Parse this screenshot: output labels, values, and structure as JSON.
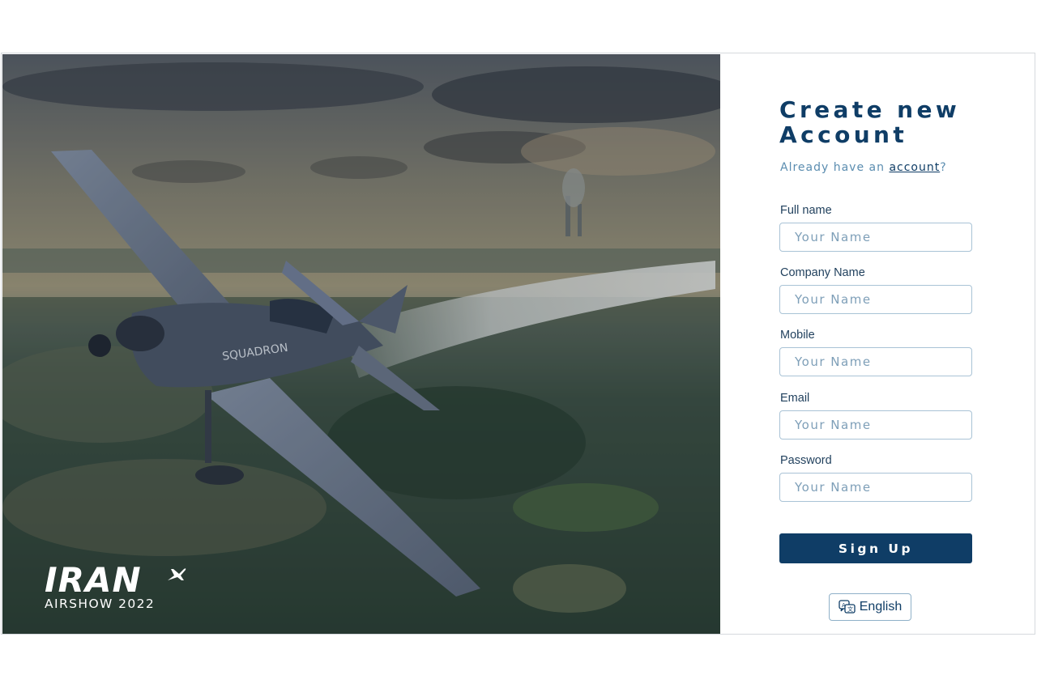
{
  "hero": {
    "logo_brand": "IRAN",
    "logo_sub": "AIRSHOW 2022",
    "plane_marking": "SQUADRON"
  },
  "form": {
    "title_line1": "Create new",
    "title_line2": "Account",
    "already_prefix": "Already have an ",
    "already_link": "account",
    "already_suffix": "?",
    "fields": [
      {
        "label": "Full name",
        "placeholder": "Your Name"
      },
      {
        "label": "Company Name",
        "placeholder": "Your Name"
      },
      {
        "label": "Mobile",
        "placeholder": "Your Name"
      },
      {
        "label": "Email",
        "placeholder": "Your Name"
      },
      {
        "label": "Password",
        "placeholder": "Your Name"
      }
    ],
    "submit_label": "Sign Up",
    "language_label": "English"
  },
  "colors": {
    "primary": "#0f3d66",
    "input_border": "#a9c3d6",
    "link_muted": "#5b8db0"
  },
  "icons": {
    "language": "translate-icon",
    "logo_plane": "airplane-icon"
  }
}
